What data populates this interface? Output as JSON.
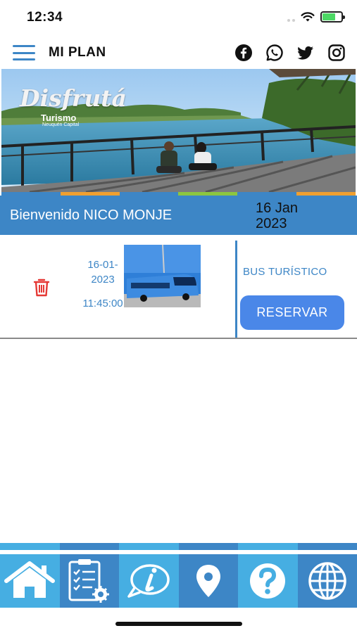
{
  "status_bar": {
    "time": "12:34"
  },
  "header": {
    "title": "MI PLAN",
    "menu_icon": "hamburger-menu-icon",
    "social_icons": [
      "facebook-icon",
      "whatsapp-icon",
      "twitter-icon",
      "instagram-icon"
    ]
  },
  "banner": {
    "logo_script": "Disfrutá",
    "logo_subtitle": "Turismo",
    "logo_tagline": "Neuquén Capital"
  },
  "welcome": {
    "greeting": "Bienvenido NICO MONJE",
    "date": "16 Jan 2023"
  },
  "plan_item": {
    "date": "16-01-2023",
    "time": "11:45:00",
    "name": "BUS TURÍSTICO",
    "reserve_label": "RESERVAR",
    "delete_icon": "trash-icon"
  },
  "bottom_nav": {
    "items": [
      {
        "icon": "home-icon"
      },
      {
        "icon": "clipboard-checklist-icon"
      },
      {
        "icon": "info-chat-icon"
      },
      {
        "icon": "location-pin-icon"
      },
      {
        "icon": "help-icon"
      },
      {
        "icon": "globe-icon"
      }
    ]
  },
  "colors": {
    "primary": "#3d86c6",
    "button": "#4a87e8",
    "nav_light": "#46aee2",
    "nav_dark": "#3d86c6",
    "delete": "#e53935"
  }
}
